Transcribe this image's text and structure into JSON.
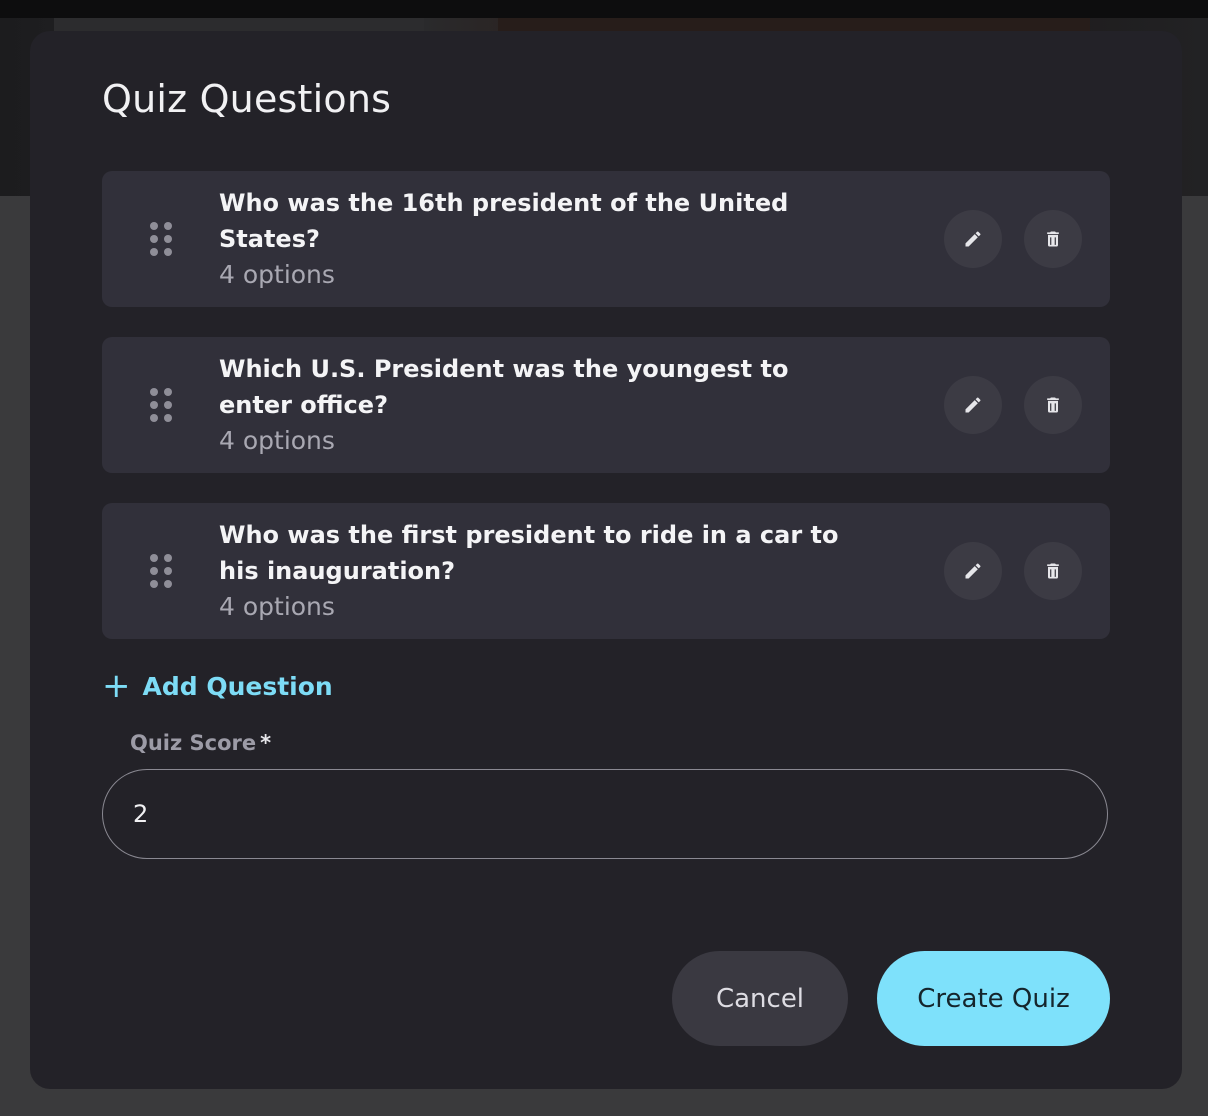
{
  "modal": {
    "title": "Quiz Questions"
  },
  "questions": [
    {
      "title": "Who was the 16th president of the United States?",
      "subtitle": "4 options"
    },
    {
      "title": "Which U.S. President was the youngest to enter office?",
      "subtitle": "4 options"
    },
    {
      "title": "Who was the first president to ride in a car to his inauguration?",
      "subtitle": "4 options"
    }
  ],
  "add_question": {
    "icon": "+",
    "label": "Add Question"
  },
  "quiz_score": {
    "label": "Quiz Score",
    "required_mark": "*",
    "value": "2"
  },
  "actions": {
    "cancel_label": "Cancel",
    "create_label": "Create Quiz"
  },
  "icons": {
    "drag": "drag-handle-icon",
    "edit": "pencil-icon",
    "delete": "trash-icon"
  },
  "colors": {
    "accent": "#7ee1fb",
    "modal_bg": "#232228",
    "card_bg": "#31303a"
  }
}
